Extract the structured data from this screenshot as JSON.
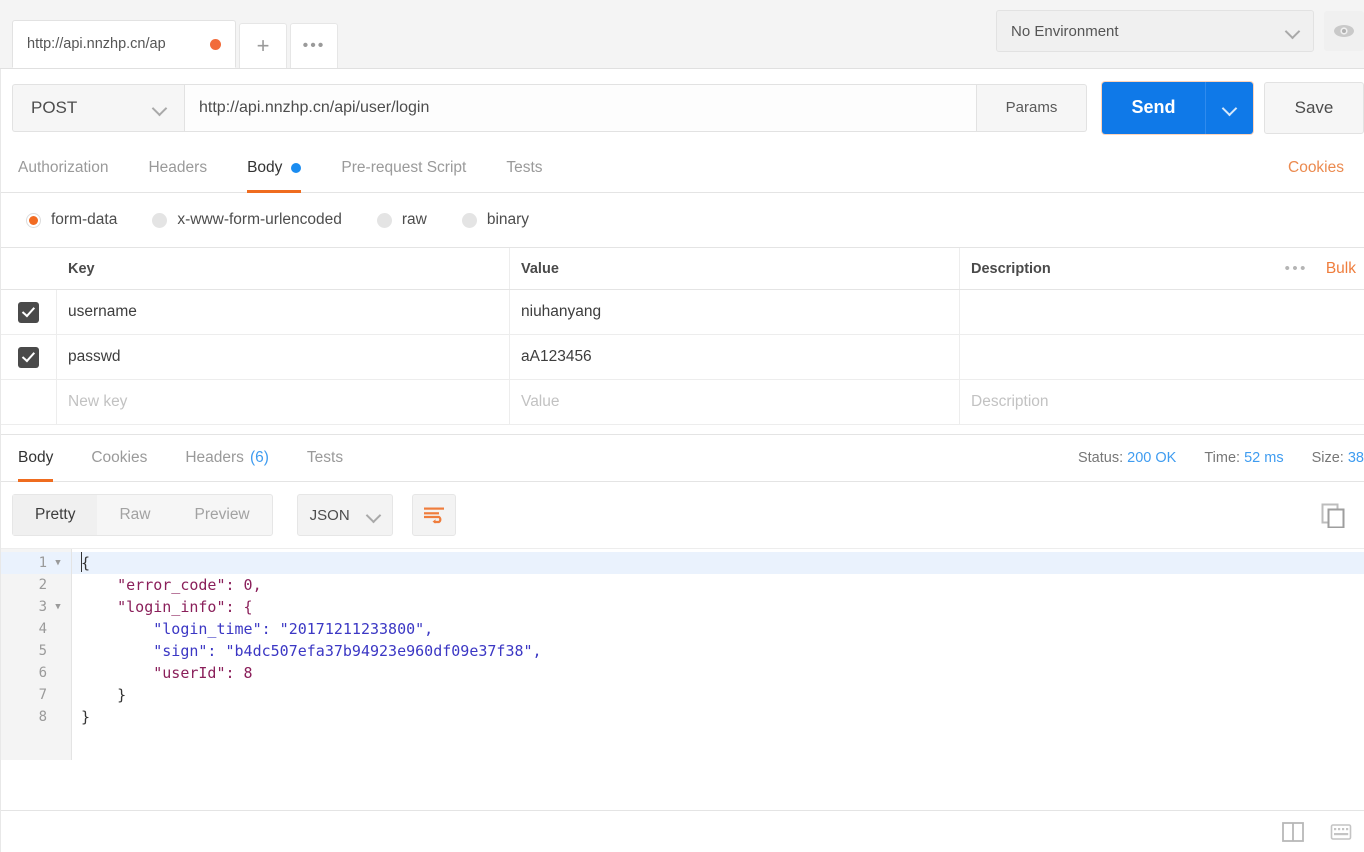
{
  "tabbar": {
    "request_tab_label": "http://api.nnzhp.cn/ap",
    "unsaved_indicator": "unsaved-dot",
    "new_tab_label": "+",
    "more_tabs_label": "•••",
    "environment": {
      "selected": "No Environment",
      "chevron": "chevron-down-icon",
      "eye_icon": "eye-icon"
    }
  },
  "urlbar": {
    "method": "POST",
    "method_chevron": "chevron-down-icon",
    "url": "http://api.nnzhp.cn/api/user/login",
    "params_label": "Params",
    "send_label": "Send",
    "send_chevron": "chevron-down-icon",
    "save_label": "Save",
    "accent_blue": "#0f79e8"
  },
  "request_tabs": {
    "items": [
      {
        "label": "Authorization",
        "active": false
      },
      {
        "label": "Headers",
        "active": false
      },
      {
        "label": "Body",
        "active": true,
        "dot": true
      },
      {
        "label": "Pre-request Script",
        "active": false
      },
      {
        "label": "Tests",
        "active": false
      }
    ],
    "cookies_label": "Cookies",
    "active_underline_color": "#ef6c1f"
  },
  "body_types": {
    "options": [
      {
        "label": "form-data",
        "checked": true
      },
      {
        "label": "x-www-form-urlencoded",
        "checked": false
      },
      {
        "label": "raw",
        "checked": false
      },
      {
        "label": "binary",
        "checked": false
      }
    ],
    "selected_color": "#f26b22"
  },
  "kv_table": {
    "columns": [
      "Key",
      "Value",
      "Description"
    ],
    "more_actions": "•••",
    "bulk_edit_label": "Bulk",
    "rows": [
      {
        "checked": true,
        "key": "username",
        "value": "niuhanyang",
        "description": ""
      },
      {
        "checked": true,
        "key": "passwd",
        "value": "aA123456",
        "description": ""
      }
    ],
    "new_row": {
      "key_placeholder": "New key",
      "value_placeholder": "Value",
      "description_placeholder": "Description"
    }
  },
  "response": {
    "tabs": [
      {
        "label": "Body",
        "active": true
      },
      {
        "label": "Cookies",
        "active": false
      },
      {
        "label": "Headers",
        "active": false,
        "count": "(6)"
      },
      {
        "label": "Tests",
        "active": false
      }
    ],
    "meta": {
      "status_label": "Status:",
      "status_value": "200 OK",
      "time_label": "Time:",
      "time_value": "52 ms",
      "size_label": "Size:",
      "size_value": "38"
    },
    "toolbar": {
      "view_modes": [
        {
          "label": "Pretty",
          "active": true
        },
        {
          "label": "Raw",
          "active": false
        },
        {
          "label": "Preview",
          "active": false
        }
      ],
      "format": "JSON",
      "format_chevron": "chevron-down-icon",
      "wrap_lines_icon": "wrap-lines-icon",
      "copy_icon": "copy-icon"
    },
    "code": {
      "line_numbers": [
        "1",
        "2",
        "3",
        "4",
        "5",
        "6",
        "7",
        "8"
      ],
      "lines": [
        "{",
        "    \"error_code\": 0,",
        "    \"login_info\": {",
        "        \"login_time\": \"20171211233800\",",
        "        \"sign\": \"b4dc507efa37b94923e960df09e37f38\",",
        "        \"userId\": 8",
        "    }",
        "}"
      ],
      "values": {
        "error_code": 0,
        "login_time": "20171211233800",
        "sign": "b4dc507efa37b94923e960df09e37f38",
        "userId": 8
      }
    }
  },
  "footer": {
    "layout_toggle_icon": "two-pane-layout-icon",
    "keyboard_shortcuts_icon": "keyboard-icon"
  }
}
